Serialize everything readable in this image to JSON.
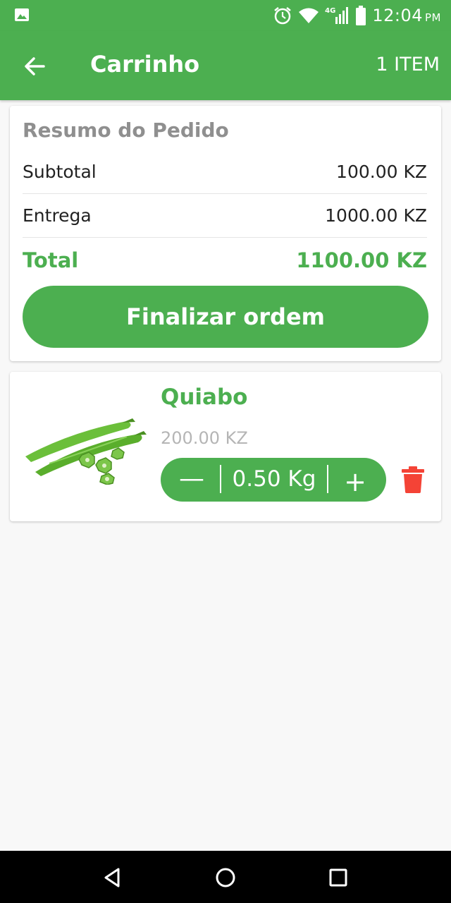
{
  "status_bar": {
    "network": "4G",
    "time": "12:04",
    "ampm": "PM",
    "icons": [
      "image-icon",
      "alarm-icon",
      "wifi-icon",
      "signal-icon",
      "battery-icon"
    ]
  },
  "appbar": {
    "title": "Carrinho",
    "item_count": "1 ITEM"
  },
  "summary": {
    "heading": "Resumo do Pedido",
    "subtotal_label": "Subtotal",
    "subtotal_value": "100.00 KZ",
    "delivery_label": "Entrega",
    "delivery_value": "1000.00 KZ",
    "total_label": "Total",
    "total_value": "1100.00 KZ",
    "checkout_label": "Finalizar ordem"
  },
  "cart_items": [
    {
      "name": "Quiabo",
      "price": "200.00 KZ",
      "quantity": "0.50 Kg",
      "minus_label": "—",
      "plus_label": "+"
    }
  ],
  "colors": {
    "primary": "#4caf50",
    "delete": "#f44336",
    "muted_text": "#b5b5b5"
  }
}
